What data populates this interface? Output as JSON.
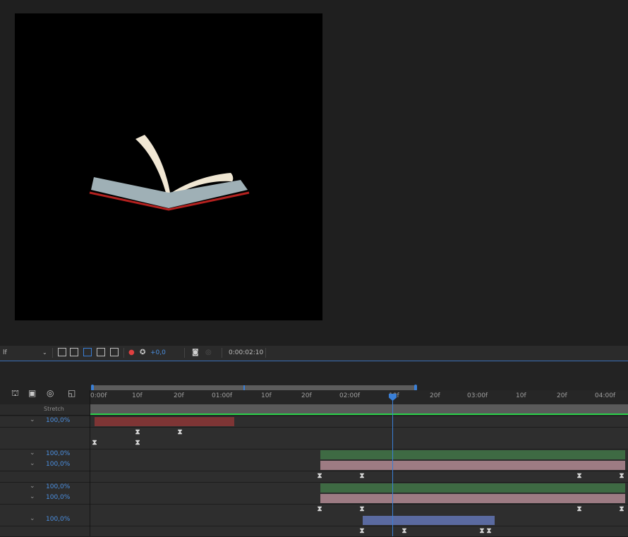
{
  "colors": {
    "panel_bg": "#232323",
    "canvas_bg": "#000000",
    "accent_blue": "#3a7fd6",
    "bar_red": "#7e3535",
    "bar_green": "#3e6a43",
    "bar_pink": "#9d7b83",
    "bar_blue": "#5a6aa0",
    "work_area_green": "#2bd24a"
  },
  "viewer_toolbar": {
    "magnification": "lf",
    "exposure": "+0,0",
    "timecode": "0:00:02:10",
    "icons": [
      "dropdown-chevron-icon",
      "region-of-interest-icon",
      "transparency-grid-icon",
      "mask-path-icon",
      "safe-zones-icon",
      "grid-icon",
      "channel-icon",
      "exposure-reset-icon",
      "snapshot-camera-icon",
      "show-snapshot-icon"
    ]
  },
  "timeline": {
    "header_icons": [
      "draft-3d-icon",
      "frame-blending-icon",
      "motion-blur-icon",
      "graph-editor-icon"
    ],
    "column_header": "Stretch",
    "ruler_labels": [
      "0:00f",
      "10f",
      "20f",
      "01:00f",
      "10f",
      "20f",
      "02:00f",
      "10f",
      "20f",
      "03:00f",
      "10f",
      "20f",
      "04:00f"
    ],
    "stretch_values": [
      "100,0%",
      "100,0%",
      "100,0%",
      "100,0%",
      "100,0%",
      "100,0%"
    ],
    "current_time_indicator_label": "10f"
  }
}
